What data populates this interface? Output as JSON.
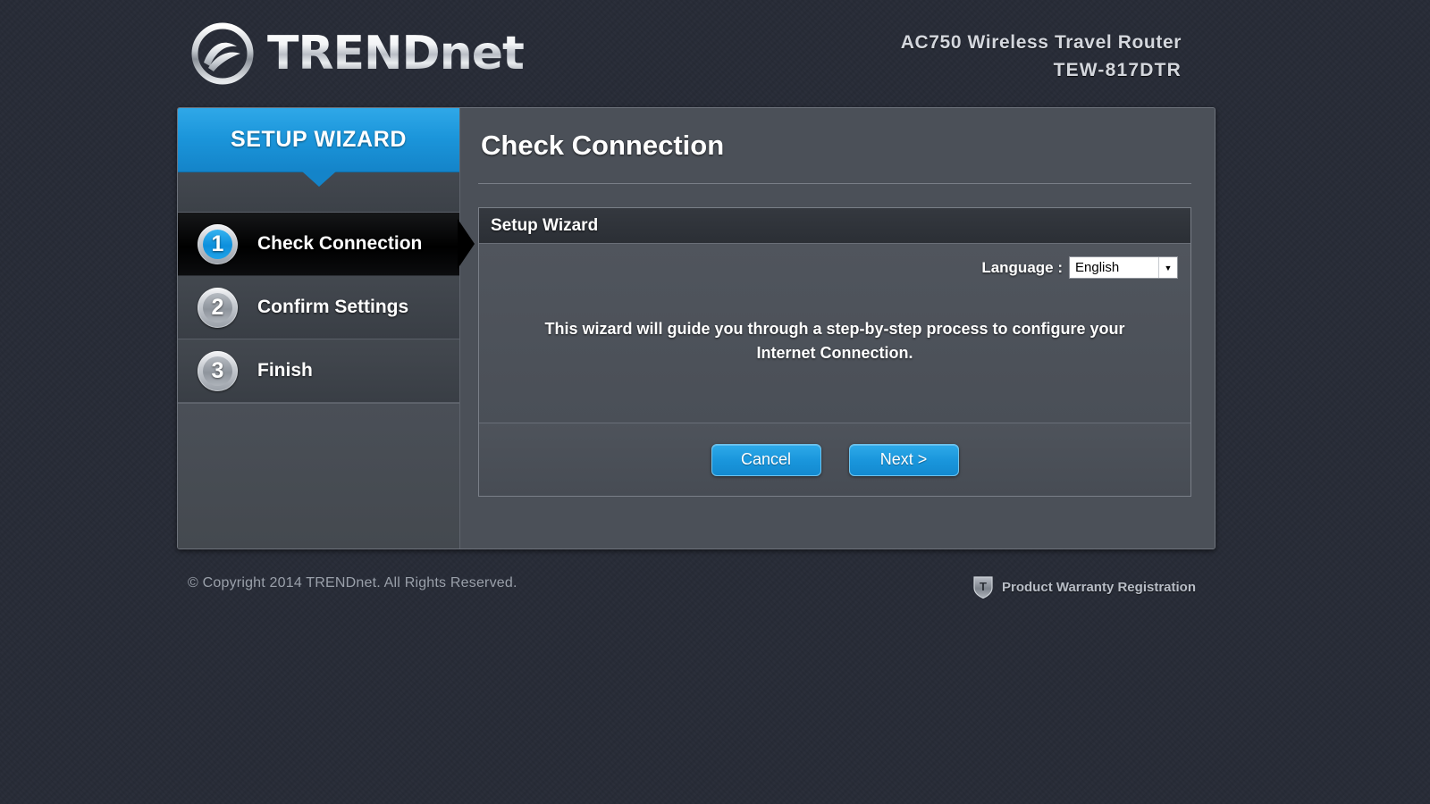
{
  "header": {
    "brand": "TRENDnet",
    "model_name": "AC750 Wireless Travel Router",
    "model_number": "TEW-817DTR"
  },
  "sidebar": {
    "tab_label": "SETUP WIZARD",
    "steps": [
      {
        "number": "1",
        "label": "Check Connection",
        "active": true
      },
      {
        "number": "2",
        "label": "Confirm Settings",
        "active": false
      },
      {
        "number": "3",
        "label": "Finish",
        "active": false
      }
    ]
  },
  "content": {
    "page_title": "Check Connection",
    "panel_header": "Setup Wizard",
    "language_label": "Language :",
    "language_value": "English",
    "language_options": [
      "English"
    ],
    "description": "This wizard will guide you through a step-by-step process to configure your Internet Connection.",
    "cancel_label": "Cancel",
    "next_label": "Next >"
  },
  "footer": {
    "copyright": "© Copyright 2014 TRENDnet. All Rights Reserved.",
    "warranty_label": "Product Warranty Registration"
  },
  "colors": {
    "accent_blue": "#1a96dc",
    "page_background": "#262b36",
    "panel_background": "#4b5058",
    "active_step": "#000000"
  }
}
